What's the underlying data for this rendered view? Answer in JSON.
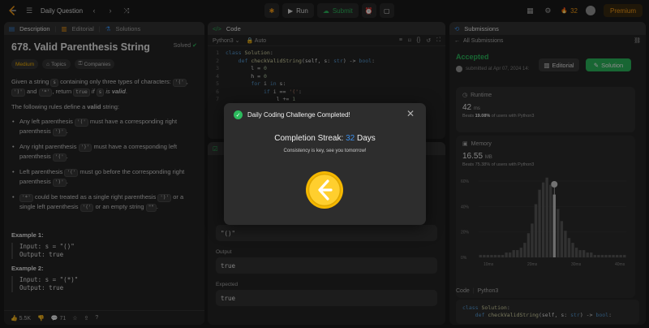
{
  "topbar": {
    "title": "Daily Question",
    "run": "Run",
    "submit": "Submit",
    "streak": "32",
    "premium": "Premium"
  },
  "description": {
    "tabs": [
      "Description",
      "Editorial",
      "Solutions"
    ],
    "title": "678. Valid Parenthesis String",
    "solved": "Solved",
    "tags": [
      "Medium",
      "Topics",
      "Companies"
    ],
    "intro_a": "Given a string ",
    "intro_s": "s",
    "intro_b": " containing only three types of characters: ",
    "c1": "'('",
    "c2": "')'",
    "intro_and": "and ",
    "c3": "'*'",
    "intro_c": ", return ",
    "c_true": "true",
    "intro_d": " if ",
    "intro_s2": "s",
    "intro_e": " is ",
    "intro_valid": "valid",
    "intro_dot": ".",
    "rules_a": "The following rules define a ",
    "rules_valid": "valid",
    "rules_b": " string:",
    "b1_a": "Any left parenthesis ",
    "b1_c": "'('",
    "b1_b": " must have a corresponding right parenthesis ",
    "b1_d": "')'",
    "b1_e": ".",
    "b2_a": "Any right parenthesis ",
    "b2_c": "')'",
    "b2_b": " must have a corresponding left parenthesis ",
    "b2_d": "'('",
    "b2_e": ".",
    "b3_a": "Left parenthesis ",
    "b3_c": "'('",
    "b3_b": " must go before the corresponding right parenthesis ",
    "b3_d": "')'",
    "b3_e": ".",
    "b4_c": "'*'",
    "b4_a": " could be treated as a single right parenthesis ",
    "b4_d": "')'",
    "b4_b": " or a single left parenthesis ",
    "b4_e": "'('",
    "b4_f": " or an empty string ",
    "b4_g": "\"\"",
    "b4_h": ".",
    "ex1_title": "Example 1:",
    "ex1_input": "Input: s = \"()\"",
    "ex1_output": "Output: true",
    "ex2_title": "Example 2:",
    "ex2_input": "Input: s = \"(*)\"",
    "ex2_output": "Output: true",
    "likes": "5.5K",
    "comments": "71"
  },
  "code": {
    "tab": "Code",
    "lang": "Python3",
    "auto": "Auto",
    "lines": [
      "class Solution:",
      "    def checkValidString(self, s: str) -> bool:",
      "        l = 0",
      "        h = 0",
      "        for i in s:",
      "            if i == '(':",
      "                l += 1"
    ]
  },
  "testcase": {
    "input_value": "\"()\"",
    "output_label": "Output",
    "output_value": "true",
    "expected_label": "Expected",
    "expected_value": "true"
  },
  "submissions": {
    "tab": "Submissions",
    "all": "All Submissions",
    "status": "Accepted",
    "submitted": "submitted at Apr 07, 2024 14:",
    "editorial": "Editorial",
    "solution": "Solution",
    "runtime_label": "Runtime",
    "runtime_value": "42",
    "runtime_unit": "ms",
    "runtime_beats": "Beats",
    "runtime_pct": "19.08%",
    "runtime_tail": "of users with Python3",
    "memory_label": "Memory",
    "memory_value": "16.55",
    "memory_unit": "MB",
    "memory_beats": "Beats 75.38% of users with Python3",
    "code_label": "Code",
    "code_lang": "Python3",
    "code_line1": "class Solution:",
    "code_line2": "    def checkValidString(self, s: str) -> bool:"
  },
  "chart_data": {
    "type": "bar",
    "ylabel_ticks": [
      "60%",
      "40%",
      "20%",
      "0%"
    ],
    "xticks": [
      "10ms",
      "20ms",
      "30ms",
      "40ms"
    ],
    "values": [
      1,
      1,
      1,
      1,
      1,
      1,
      1,
      2,
      2,
      3,
      3,
      4,
      6,
      10,
      14,
      22,
      28,
      31,
      33,
      30,
      26,
      20,
      15,
      11,
      8,
      6,
      4,
      3,
      3,
      2,
      2,
      1,
      1,
      1,
      1,
      1,
      1,
      1,
      1,
      1
    ]
  },
  "modal": {
    "title": "Daily Coding Challenge Completed!",
    "streak_label": "Completion Streak:",
    "streak_value": "32",
    "streak_unit": "Days",
    "subtitle": "Consistency is key, see you tomorrow!"
  },
  "colors": {
    "accent": "#ffa116",
    "green": "#2cbb5d",
    "blue": "#3b8eea"
  }
}
